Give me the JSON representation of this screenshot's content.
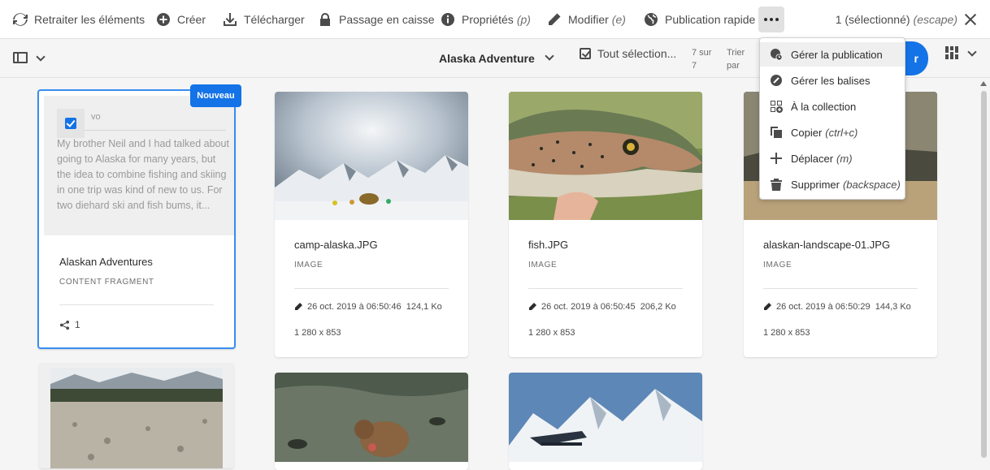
{
  "toolbar": {
    "reprocess_label": "Retraiter les éléments",
    "create_label": "Créer",
    "download_label": "Télécharger",
    "checkout_label": "Passage en caisse",
    "properties_label": "Propriétés",
    "properties_shortcut": "(p)",
    "edit_label": "Modifier",
    "edit_shortcut": "(e)",
    "quick_publish_label": "Publication rapide",
    "selected_label": "1 (sélectionné)",
    "escape_hint": "(escape)"
  },
  "subbar": {
    "folder_title": "Alaska Adventure",
    "select_all_label": "Tout sélection...",
    "count_text": "7 sur 7",
    "sort_label": "Trier par",
    "create_label": "Créer"
  },
  "menu": {
    "items": [
      {
        "label": "Gérer la publication",
        "shortcut": ""
      },
      {
        "label": "Gérer les balises",
        "shortcut": ""
      },
      {
        "label": "À la collection",
        "shortcut": ""
      },
      {
        "label": "Copier",
        "shortcut": "(ctrl+c)"
      },
      {
        "label": "Déplacer",
        "shortcut": "(m)"
      },
      {
        "label": "Supprimer",
        "shortcut": "(backspace)"
      }
    ]
  },
  "fragment_card": {
    "badge": "Nouveau",
    "ghost_title": "vo",
    "excerpt": "My brother Neil and I had talked about going to Alaska for many years, but the idea to combine fishing and skiing in one trip was kind of new to us. For two diehard ski and fish bums, it...",
    "title": "Alaskan Adventures",
    "type": "CONTENT FRAGMENT",
    "references": "1"
  },
  "assets": [
    {
      "name": "camp-alaska.JPG",
      "type": "IMAGE",
      "date": "26 oct. 2019 à 06:50:46",
      "size": "124,1 Ko",
      "dims": "1 280 x 853"
    },
    {
      "name": "fish.JPG",
      "type": "IMAGE",
      "date": "26 oct. 2019 à 06:50:45",
      "size": "206,2 Ko",
      "dims": "1 280 x 853"
    },
    {
      "name": "alaskan-landscape-01.JPG",
      "type": "IMAGE",
      "date": "26 oct. 2019 à 06:50:29",
      "size": "144,3 Ko",
      "dims": "1 280 x 853"
    }
  ],
  "colors": {
    "accent": "#1473e6",
    "selection": "#378ef0"
  }
}
